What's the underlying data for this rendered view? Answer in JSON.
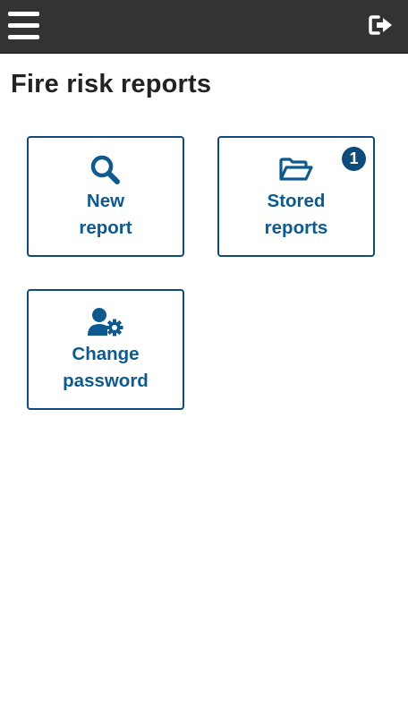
{
  "header": {
    "menu_icon": "hamburger-menu-icon",
    "logout_icon": "sign-out-icon"
  },
  "page": {
    "title": "Fire risk reports"
  },
  "tiles": [
    {
      "icon": "search-icon",
      "label_line1": "New",
      "label_line2": "report"
    },
    {
      "icon": "folder-open-icon",
      "label_line1": "Stored",
      "label_line2": "reports",
      "badge": "1"
    },
    {
      "icon": "user-cog-icon",
      "label_line1": "Change",
      "label_line2": "password"
    }
  ],
  "colors": {
    "topbar": "#333333",
    "accent": "#0e5a8f",
    "border": "#0e4a7a",
    "title_text": "#222222"
  }
}
